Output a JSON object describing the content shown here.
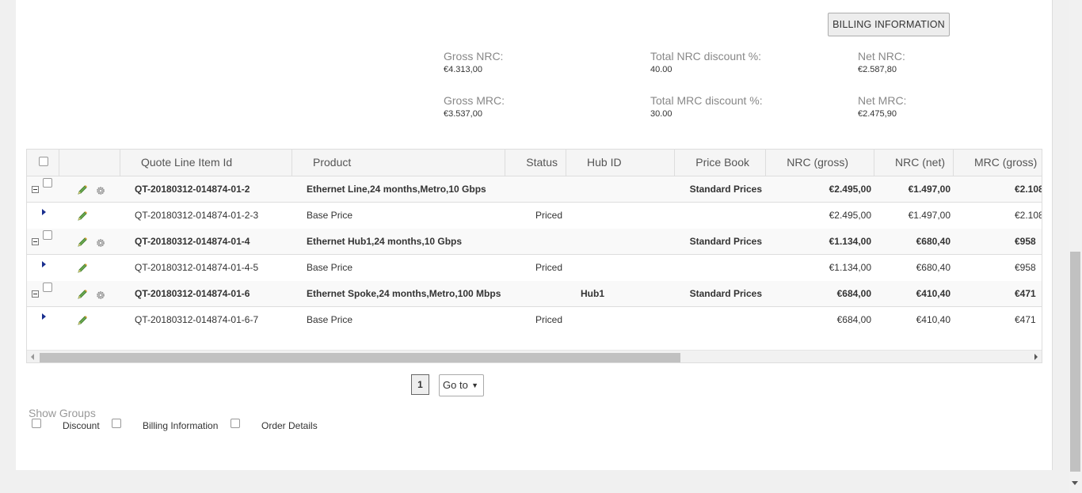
{
  "billing_button": {
    "label": "BILLING INFORMATION"
  },
  "summary": {
    "gross_nrc": {
      "label": "Gross NRC:",
      "value": "€4.313,00"
    },
    "total_nrc_discount": {
      "label": "Total NRC discount %:",
      "value": "40.00"
    },
    "net_nrc": {
      "label": "Net NRC:",
      "value": "€2.587,80"
    },
    "gross_mrc": {
      "label": "Gross MRC:",
      "value": "€3.537,00"
    },
    "total_mrc_discount": {
      "label": "Total MRC discount %:",
      "value": "30.00"
    },
    "net_mrc": {
      "label": "Net MRC:",
      "value": "€2.475,90"
    }
  },
  "table": {
    "headers": {
      "quote_line_item_id": "Quote Line Item Id",
      "product": "Product",
      "status": "Status",
      "hub_id": "Hub ID",
      "price_book": "Price Book",
      "nrc_gross": "NRC (gross)",
      "nrc_net": "NRC (net)",
      "mrc_gross": "MRC (gross)"
    },
    "rows": [
      {
        "type": "group",
        "id": "QT-20180312-014874-01-2",
        "product": "Ethernet Line,24 months,Metro,10 Gbps",
        "status": "",
        "hub": "",
        "price_book": "Standard Prices",
        "nrc_gross": "€2.495,00",
        "nrc_net": "€1.497,00",
        "mrc_gross": "€2.108"
      },
      {
        "type": "child",
        "id": "QT-20180312-014874-01-2-3",
        "product": "Base Price",
        "status": "Priced",
        "hub": "",
        "price_book": "",
        "nrc_gross": "€2.495,00",
        "nrc_net": "€1.497,00",
        "mrc_gross": "€2.108"
      },
      {
        "type": "group",
        "id": "QT-20180312-014874-01-4",
        "product": "Ethernet Hub1,24 months,10 Gbps",
        "status": "",
        "hub": "",
        "price_book": "Standard Prices",
        "nrc_gross": "€1.134,00",
        "nrc_net": "€680,40",
        "mrc_gross": "€958"
      },
      {
        "type": "child",
        "id": "QT-20180312-014874-01-4-5",
        "product": "Base Price",
        "status": "Priced",
        "hub": "",
        "price_book": "",
        "nrc_gross": "€1.134,00",
        "nrc_net": "€680,40",
        "mrc_gross": "€958"
      },
      {
        "type": "group",
        "id": "QT-20180312-014874-01-6",
        "product": "Ethernet Spoke,24 months,Metro,100 Mbps",
        "status": "",
        "hub": "Hub1",
        "price_book": "Standard Prices",
        "nrc_gross": "€684,00",
        "nrc_net": "€410,40",
        "mrc_gross": "€471"
      },
      {
        "type": "child",
        "id": "QT-20180312-014874-01-6-7",
        "product": "Base Price",
        "status": "Priced",
        "hub": "",
        "price_book": "",
        "nrc_gross": "€684,00",
        "nrc_net": "€410,40",
        "mrc_gross": "€471"
      }
    ]
  },
  "pagination": {
    "current_page": "1",
    "goto_label": "Go to"
  },
  "show_groups": {
    "title": "Show Groups",
    "options": [
      "Discount",
      "Billing Information",
      "Order Details"
    ]
  },
  "icons": {
    "edit": "pencil-edit-icon",
    "settings": "gear-icon",
    "expand": "expand-arrow-icon",
    "collapse": "collapse-minus-icon"
  }
}
